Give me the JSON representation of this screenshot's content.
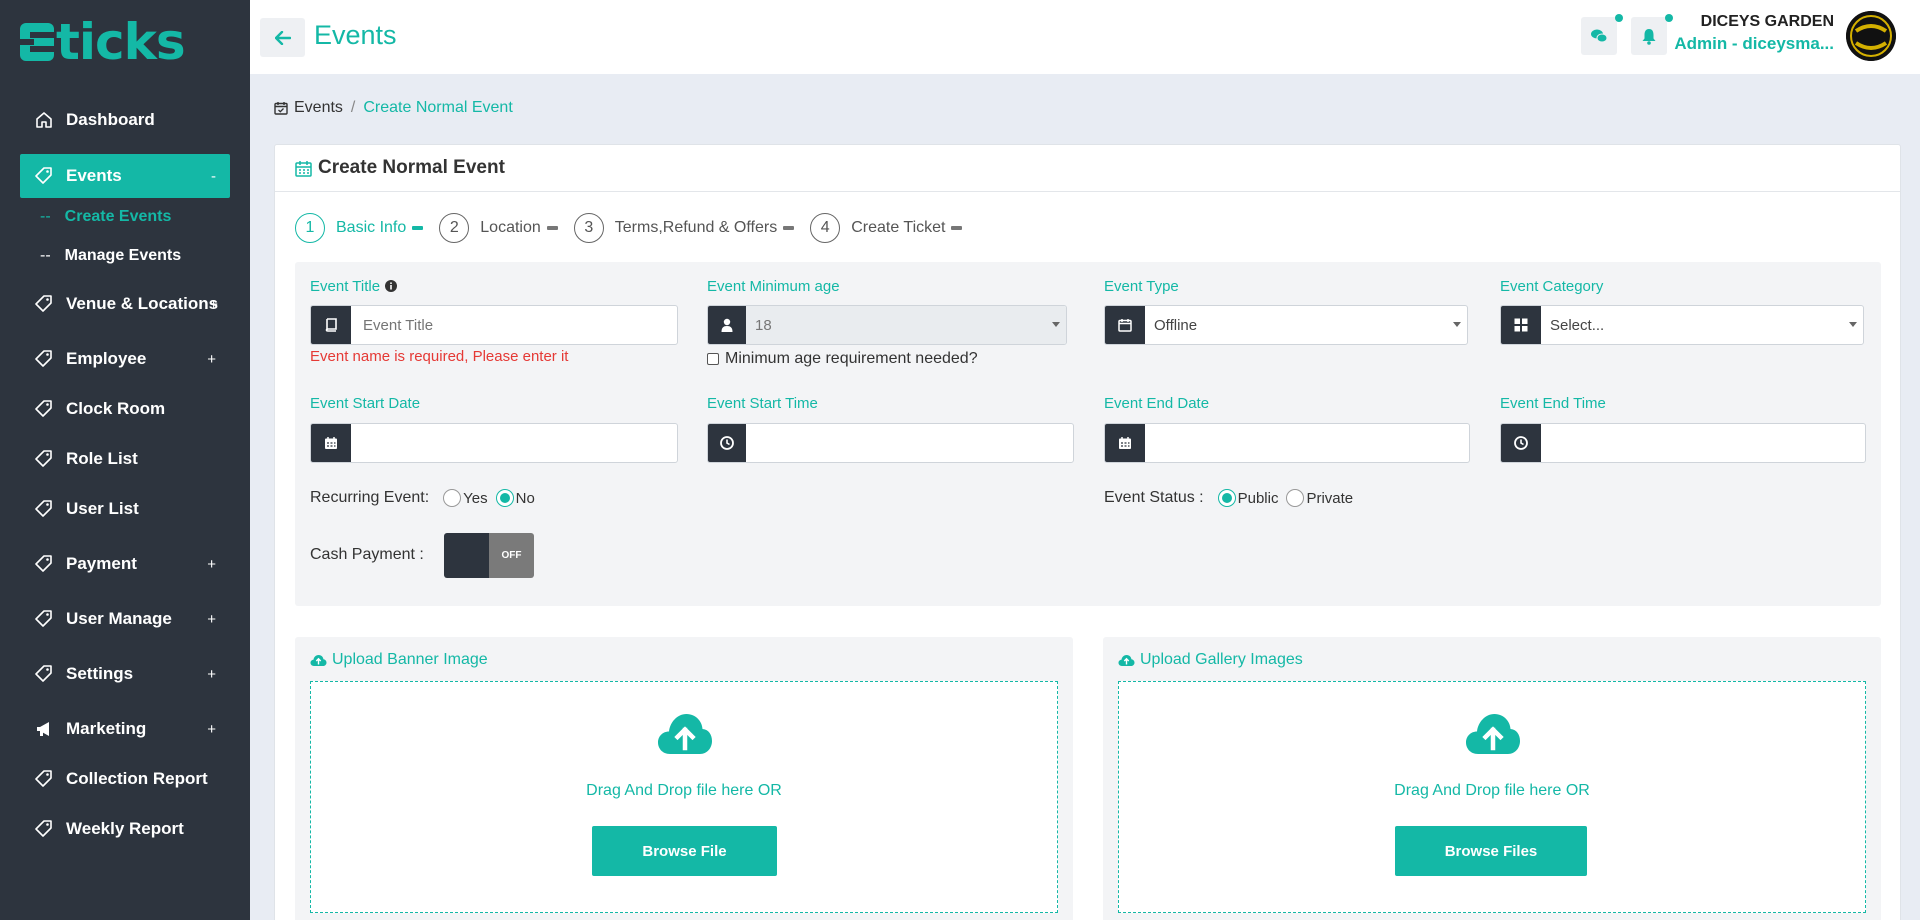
{
  "app": {
    "logo_text": "ticks"
  },
  "colors": {
    "accent": "#14b8a6",
    "sidebar": "#2d343e",
    "error": "#e53935"
  },
  "sidebar": {
    "items": [
      {
        "label": "Dashboard",
        "icon": "home-icon",
        "expander": ""
      },
      {
        "label": "Events",
        "icon": "tag-icon",
        "expander": "-"
      },
      {
        "label": "Venue & Locations",
        "icon": "tag-icon",
        "expander": "+"
      },
      {
        "label": "Employee",
        "icon": "tag-icon",
        "expander": "+"
      },
      {
        "label": "Clock Room",
        "icon": "tag-icon",
        "expander": ""
      },
      {
        "label": "Role List",
        "icon": "tag-icon",
        "expander": ""
      },
      {
        "label": "User List",
        "icon": "tag-icon",
        "expander": ""
      },
      {
        "label": "Payment",
        "icon": "tag-icon",
        "expander": "+"
      },
      {
        "label": "User Manage",
        "icon": "tag-icon",
        "expander": "+"
      },
      {
        "label": "Settings",
        "icon": "tag-icon",
        "expander": "+"
      },
      {
        "label": "Marketing",
        "icon": "megaphone-icon",
        "expander": "+"
      },
      {
        "label": "Collection Report",
        "icon": "tag-icon",
        "expander": ""
      },
      {
        "label": "Weekly Report",
        "icon": "tag-icon",
        "expander": ""
      }
    ],
    "subitems": [
      {
        "dash": "--",
        "label": "Create Events"
      },
      {
        "dash": "--",
        "label": "Manage Events"
      }
    ]
  },
  "header": {
    "title": "Events",
    "user_name": "DICEYS GARDEN",
    "user_role": "Admin - diceysma..."
  },
  "breadcrumb": {
    "first": "Events",
    "separator": "/",
    "current": "Create Normal Event"
  },
  "card": {
    "title": "Create Normal Event"
  },
  "steps": [
    {
      "num": "1",
      "label": "Basic Info"
    },
    {
      "num": "2",
      "label": "Location"
    },
    {
      "num": "3",
      "label": "Terms,Refund & Offers"
    },
    {
      "num": "4",
      "label": "Create Ticket"
    }
  ],
  "form": {
    "event_title": {
      "label": "Event Title",
      "placeholder": "Event Title",
      "error": "Event name is required, Please enter it"
    },
    "min_age": {
      "label": "Event Minimum age",
      "value": "18",
      "checkbox_label": "Minimum age requirement needed?"
    },
    "event_type": {
      "label": "Event Type",
      "value": "Offline"
    },
    "event_category": {
      "label": "Event Category",
      "value": "Select..."
    },
    "start_date": {
      "label": "Event Start Date"
    },
    "start_time": {
      "label": "Event Start Time"
    },
    "end_date": {
      "label": "Event End Date"
    },
    "end_time": {
      "label": "Event End Time"
    },
    "recurring": {
      "label": "Recurring Event:",
      "yes": "Yes",
      "no": "No"
    },
    "status": {
      "label": "Event Status :",
      "public": "Public",
      "private": "Private"
    },
    "cash": {
      "label": "Cash Payment :",
      "toggle": "OFF"
    }
  },
  "upload": {
    "banner": {
      "title": "Upload Banner Image",
      "drop_text": "Drag And Drop file here OR",
      "button": "Browse File"
    },
    "gallery": {
      "title": "Upload Gallery Images",
      "drop_text": "Drag And Drop file here OR",
      "button": "Browse Files"
    }
  }
}
